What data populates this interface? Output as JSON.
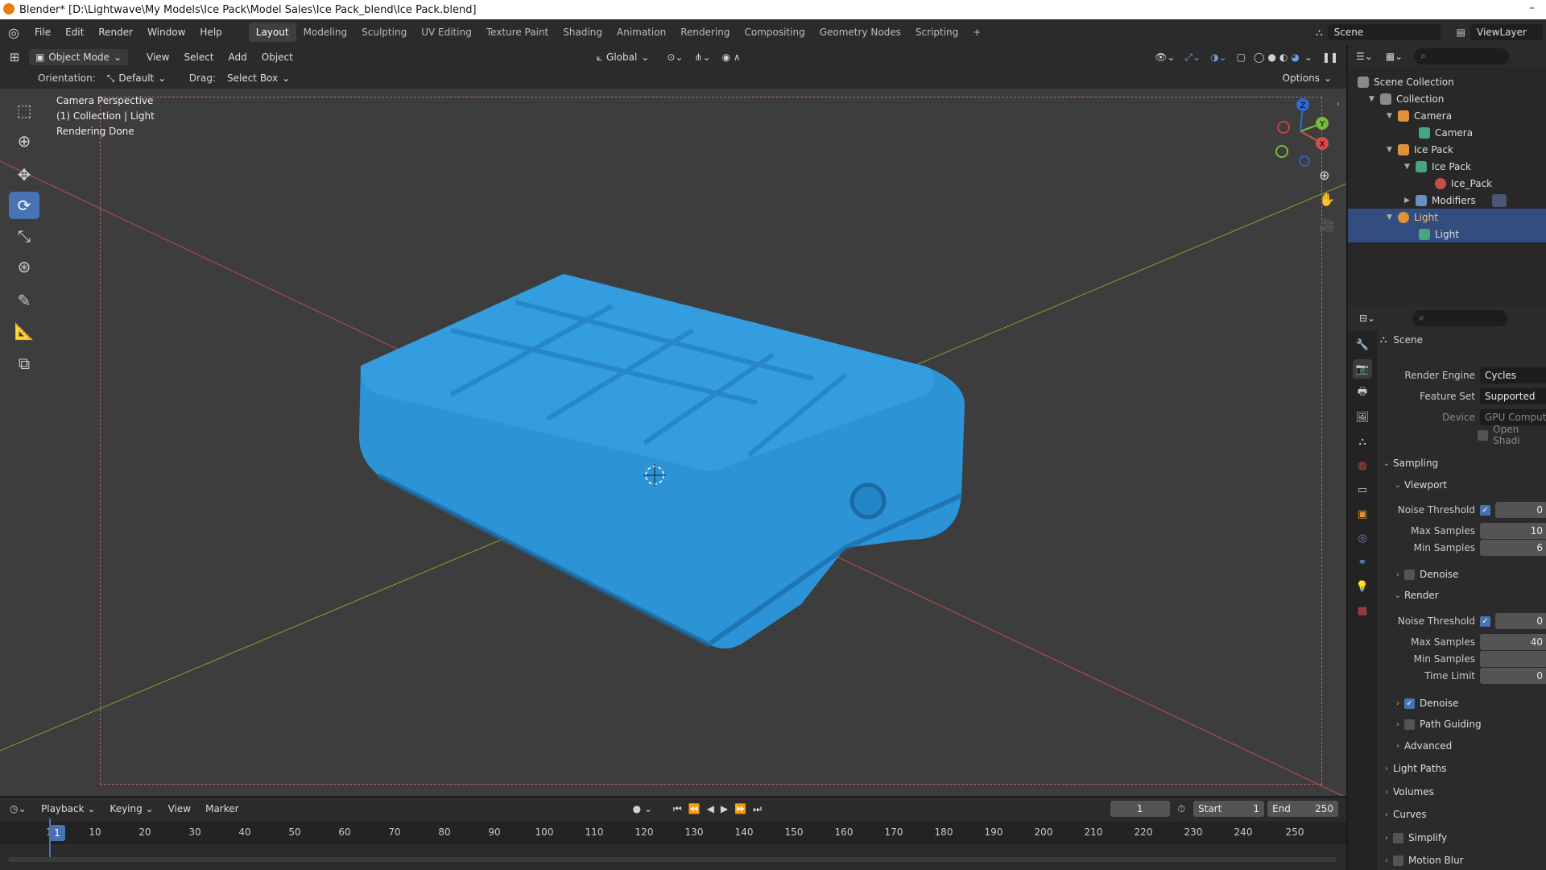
{
  "window": {
    "title": "Blender* [D:\\Lightwave\\My Models\\Ice Pack\\Model Sales\\Ice Pack_blend\\Ice Pack.blend]",
    "minimize": "–"
  },
  "menus": [
    "File",
    "Edit",
    "Render",
    "Window",
    "Help"
  ],
  "workspaces": [
    "Layout",
    "Modeling",
    "Sculpting",
    "UV Editing",
    "Texture Paint",
    "Shading",
    "Animation",
    "Rendering",
    "Compositing",
    "Geometry Nodes",
    "Scripting",
    "+"
  ],
  "active_workspace": "Layout",
  "scene_field": "Scene",
  "viewlayer_field": "ViewLayer",
  "viewport_header": {
    "mode": "Object Mode",
    "menus": [
      "View",
      "Select",
      "Add",
      "Object"
    ],
    "transform": "Global"
  },
  "tool_options": {
    "orientation_label": "Orientation:",
    "orientation_value": "Default",
    "drag_label": "Drag:",
    "drag_value": "Select Box",
    "options": "Options"
  },
  "viewport_overlay": {
    "line1": "Camera Perspective",
    "line2": "(1) Collection | Light",
    "line3": "Rendering Done"
  },
  "gizmo": {
    "x": "X",
    "y": "Y",
    "z": "Z"
  },
  "object_color": "#2b93d6",
  "outliner": {
    "items": [
      {
        "label": "Scene Collection",
        "color": "#d7d7d7",
        "tri": ""
      },
      {
        "label": "Collection",
        "color": "#d7d7d7",
        "tri": "▼"
      },
      {
        "label": "Camera",
        "color": "#e0913a",
        "tri": "▼"
      },
      {
        "label": "Camera",
        "color": "#44a87f",
        "tri": ""
      },
      {
        "label": "Ice Pack",
        "color": "#e0913a",
        "tri": "▼"
      },
      {
        "label": "Ice Pack",
        "color": "#44a87f",
        "tri": "▼"
      },
      {
        "label": "Ice_Pack",
        "color": "#c84d4d",
        "tri": ""
      },
      {
        "label": "Modifiers",
        "color": "#6a8fc6",
        "tri": "▶"
      },
      {
        "label": "Light",
        "color": "#e0913a",
        "tri": "▼"
      },
      {
        "label": "Light",
        "color": "#44a87f",
        "tri": ""
      }
    ]
  },
  "properties": {
    "context": "Scene",
    "render_engine_label": "Render Engine",
    "render_engine": "Cycles",
    "feature_set_label": "Feature Set",
    "feature_set": "Supported",
    "device_label": "Device",
    "device": "GPU Compute",
    "open_shading": "Open Shadi",
    "sampling": "Sampling",
    "viewport": "Viewport",
    "noise_threshold_label": "Noise Threshold",
    "vp_noise": "0",
    "max_samples_label": "Max Samples",
    "vp_max": "10",
    "min_samples_label": "Min Samples",
    "vp_min": "6",
    "denoise": "Denoise",
    "render": "Render",
    "r_noise": "0",
    "r_max": "40",
    "r_min": "",
    "time_limit_label": "Time Limit",
    "r_time": "0",
    "path_guiding": "Path Guiding",
    "advanced": "Advanced",
    "light_paths": "Light Paths",
    "volumes": "Volumes",
    "curves": "Curves",
    "simplify": "Simplify",
    "motion_blur": "Motion Blur"
  },
  "timeline": {
    "menus": [
      "Playback",
      "Keying",
      "View",
      "Marker"
    ],
    "current_frame": "1",
    "start_label": "Start",
    "start": "1",
    "end_label": "End",
    "end": "250",
    "ticks": [
      "1",
      "10",
      "20",
      "30",
      "40",
      "50",
      "60",
      "70",
      "80",
      "90",
      "100",
      "110",
      "120",
      "130",
      "140",
      "150",
      "160",
      "170",
      "180",
      "190",
      "200",
      "210",
      "220",
      "230",
      "240",
      "250"
    ]
  }
}
